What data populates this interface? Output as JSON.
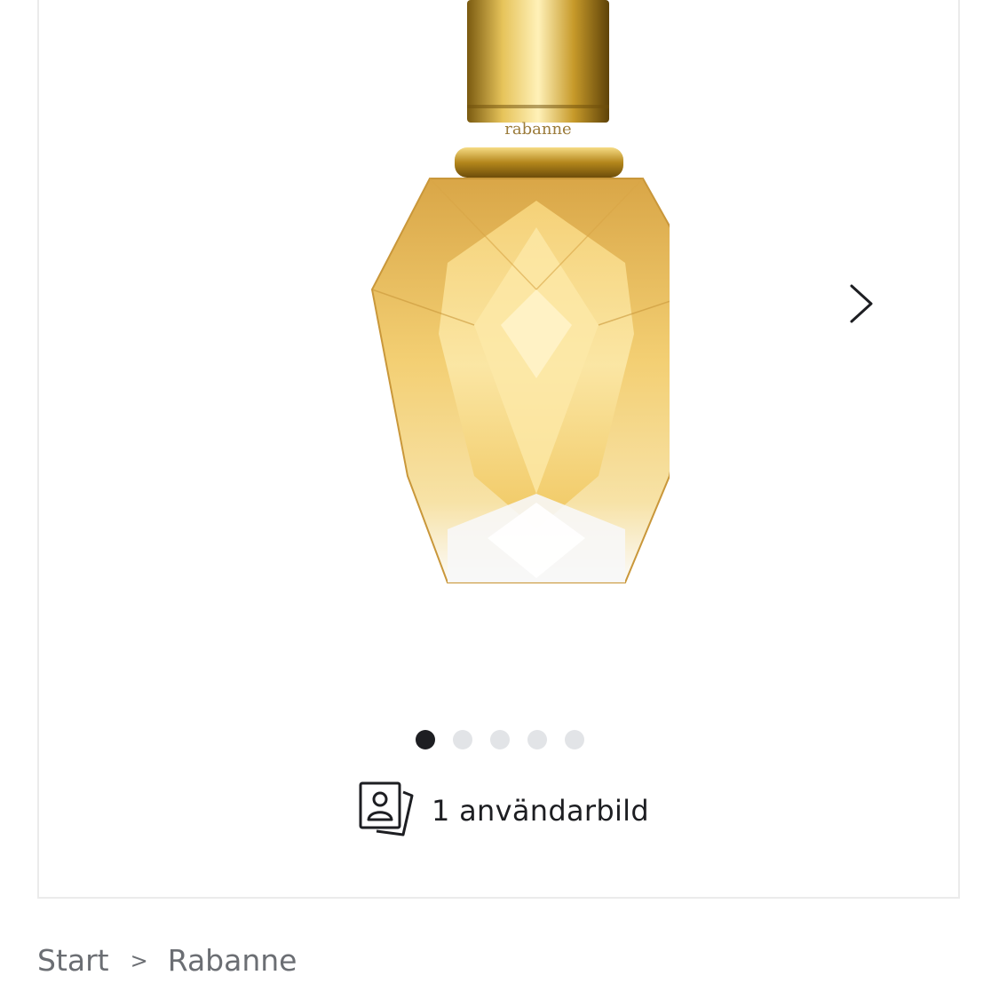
{
  "gallery": {
    "image_label": "rabanne",
    "image_count": 5,
    "active_index": 0,
    "next_icon": "chevron-right-icon",
    "user_images_icon": "user-photos-icon",
    "user_images_label": "1 användarbild"
  },
  "breadcrumb": {
    "items": [
      "Start",
      "Rabanne"
    ],
    "separator": ">"
  },
  "colors": {
    "active_dot": "#1d1e22",
    "inactive_dot": "#e2e4e7",
    "breadcrumb_text": "#6b6e73",
    "border": "#ebebeb"
  }
}
